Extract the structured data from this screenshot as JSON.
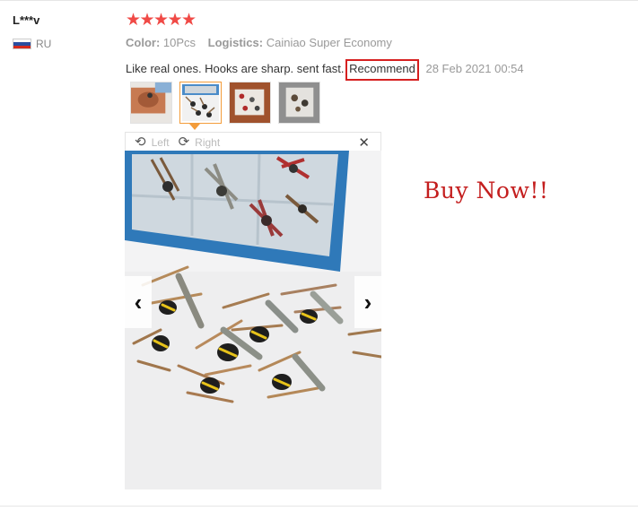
{
  "reviewer": {
    "name": "L***v",
    "country": "RU",
    "flag_colors": [
      "#ffffff",
      "#2a4ea0",
      "#d52b1e"
    ]
  },
  "rating": {
    "stars": 5,
    "max": 5,
    "star_color": "#f04a46"
  },
  "meta": {
    "color_label": "Color:",
    "color_value": "10Pcs",
    "logistics_label": "Logistics:",
    "logistics_value": "Cainiao Super Economy"
  },
  "review": {
    "text": "Like real ones. Hooks are sharp. sent fast.",
    "highlight": "Recommend",
    "date": "28 Feb 2021 00:54"
  },
  "thumbnails": [
    {
      "name": "thumb-1",
      "active": false
    },
    {
      "name": "thumb-2",
      "active": true
    },
    {
      "name": "thumb-3",
      "active": false
    },
    {
      "name": "thumb-4",
      "active": false
    }
  ],
  "viewer": {
    "rotate_left_label": "Left",
    "rotate_right_label": "Right",
    "close_icon": "close-icon",
    "prev_icon": "chevron-left-icon",
    "next_icon": "chevron-right-icon"
  },
  "promo": {
    "text": "Buy Now!!",
    "color": "#c41e1e"
  },
  "accent_color": "#f39c3a"
}
